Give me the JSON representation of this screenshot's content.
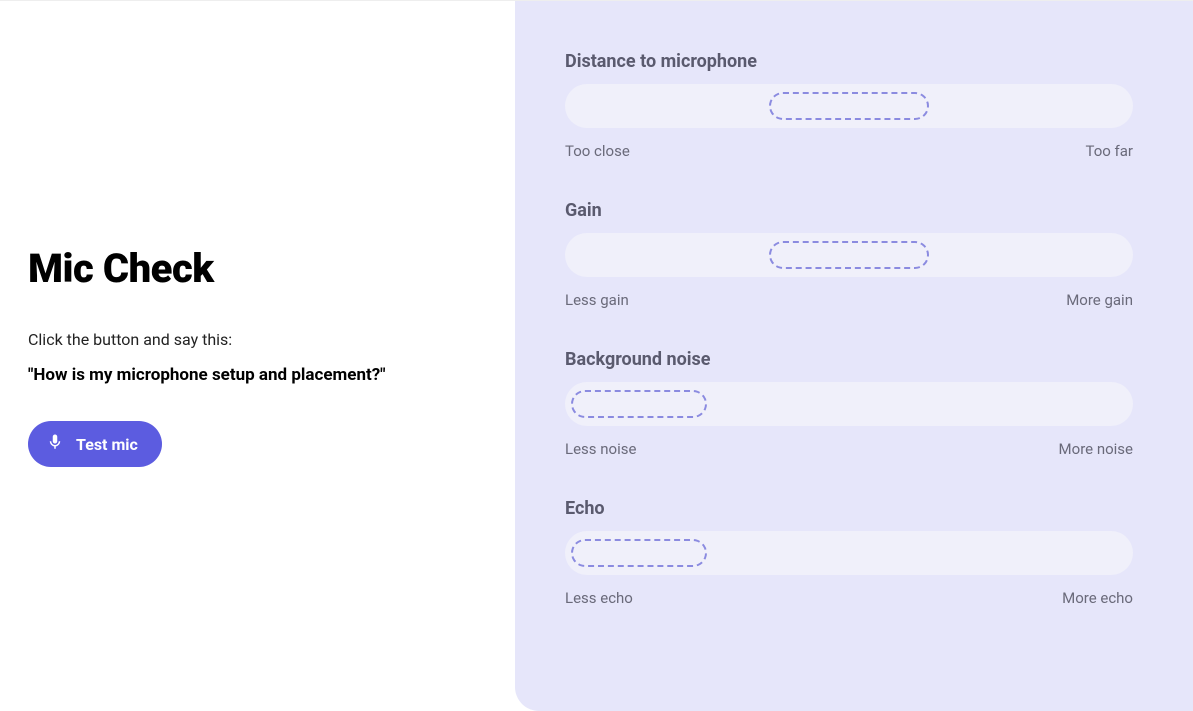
{
  "left": {
    "heading": "Mic Check",
    "instruction": "Click the button and say this:",
    "script": "\"How is my microphone setup and placement?\"",
    "button_label": "Test mic"
  },
  "metrics": [
    {
      "title": "Distance to microphone",
      "left_label": "Too close",
      "right_label": "Too far",
      "indicator_left_pct": 36,
      "indicator_width_pct": 28
    },
    {
      "title": "Gain",
      "left_label": "Less gain",
      "right_label": "More gain",
      "indicator_left_pct": 36,
      "indicator_width_pct": 28
    },
    {
      "title": "Background noise",
      "left_label": "Less noise",
      "right_label": "More noise",
      "indicator_left_pct": 1,
      "indicator_width_pct": 24
    },
    {
      "title": "Echo",
      "left_label": "Less echo",
      "right_label": "More echo",
      "indicator_left_pct": 1,
      "indicator_width_pct": 24
    }
  ]
}
